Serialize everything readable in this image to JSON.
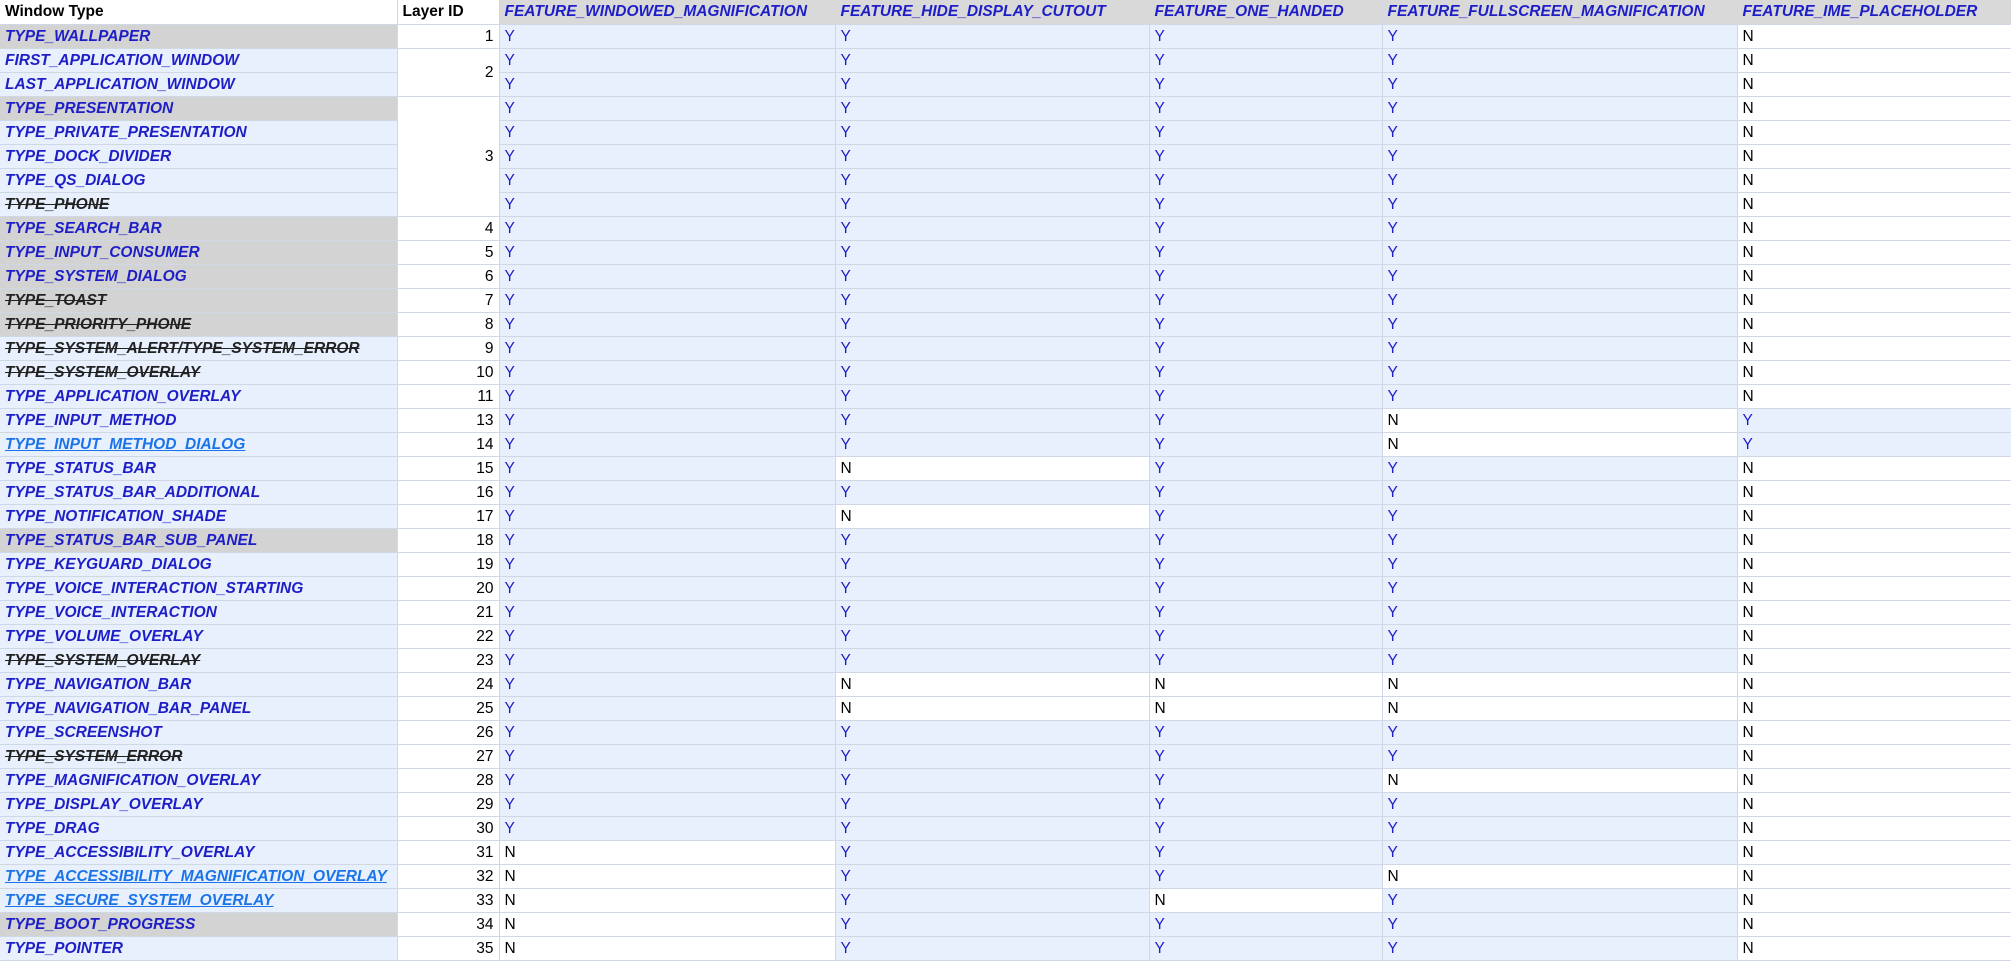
{
  "headers": [
    "Window Type",
    "Layer ID",
    "FEATURE_WINDOWED_MAGNIFICATION",
    "FEATURE_HIDE_DISPLAY_CUTOUT",
    "FEATURE_ONE_HANDED",
    "FEATURE_FULLSCREEN_MAGNIFICATION",
    "FEATURE_IME_PLACEHOLDER"
  ],
  "colors": {
    "cell_blue_bg": "#e7f0fc",
    "grey_bg": "#d3d3d3",
    "header_feature_bg": "#d9d9d9",
    "blue_text": "#1e1ec8",
    "link_text": "#1a73e8"
  },
  "rows": [
    {
      "name": "TYPE_WALLPAPER",
      "style": "blue-grey",
      "layer": "1",
      "span": 1,
      "v": [
        "Y",
        "Y",
        "Y",
        "Y",
        "N"
      ]
    },
    {
      "name": "FIRST_APPLICATION_WINDOW",
      "style": "blue",
      "layer": "2",
      "span": 2,
      "v": [
        "Y",
        "Y",
        "Y",
        "Y",
        "N"
      ]
    },
    {
      "name": "LAST_APPLICATION_WINDOW",
      "style": "blue",
      "layer": null,
      "span": 0,
      "v": [
        "Y",
        "Y",
        "Y",
        "Y",
        "N"
      ]
    },
    {
      "name": "TYPE_PRESENTATION",
      "style": "blue-grey",
      "layer": "3",
      "span": 5,
      "v": [
        "Y",
        "Y",
        "Y",
        "Y",
        "N"
      ]
    },
    {
      "name": "TYPE_PRIVATE_PRESENTATION",
      "style": "blue",
      "layer": null,
      "span": 0,
      "v": [
        "Y",
        "Y",
        "Y",
        "Y",
        "N"
      ]
    },
    {
      "name": "TYPE_DOCK_DIVIDER",
      "style": "blue",
      "layer": null,
      "span": 0,
      "v": [
        "Y",
        "Y",
        "Y",
        "Y",
        "N"
      ]
    },
    {
      "name": "TYPE_QS_DIALOG",
      "style": "blue",
      "layer": null,
      "span": 0,
      "v": [
        "Y",
        "Y",
        "Y",
        "Y",
        "N"
      ]
    },
    {
      "name": "TYPE_PHONE",
      "style": "strike",
      "layer": null,
      "span": 0,
      "v": [
        "Y",
        "Y",
        "Y",
        "Y",
        "N"
      ]
    },
    {
      "name": "TYPE_SEARCH_BAR",
      "style": "blue-grey",
      "layer": "4",
      "span": 1,
      "v": [
        "Y",
        "Y",
        "Y",
        "Y",
        "N"
      ]
    },
    {
      "name": "TYPE_INPUT_CONSUMER",
      "style": "blue-grey",
      "layer": "5",
      "span": 1,
      "v": [
        "Y",
        "Y",
        "Y",
        "Y",
        "N"
      ]
    },
    {
      "name": "TYPE_SYSTEM_DIALOG",
      "style": "blue-grey",
      "layer": "6",
      "span": 1,
      "v": [
        "Y",
        "Y",
        "Y",
        "Y",
        "N"
      ]
    },
    {
      "name": "TYPE_TOAST",
      "style": "strike-grey",
      "layer": "7",
      "span": 1,
      "v": [
        "Y",
        "Y",
        "Y",
        "Y",
        "N"
      ]
    },
    {
      "name": "TYPE_PRIORITY_PHONE",
      "style": "strike-grey",
      "layer": "8",
      "span": 1,
      "v": [
        "Y",
        "Y",
        "Y",
        "Y",
        "N"
      ]
    },
    {
      "name": "TYPE_SYSTEM_ALERT/TYPE_SYSTEM_ERROR",
      "style": "strike",
      "layer": "9",
      "span": 1,
      "v": [
        "Y",
        "Y",
        "Y",
        "Y",
        "N"
      ]
    },
    {
      "name": "TYPE_SYSTEM_OVERLAY",
      "style": "strike",
      "layer": "10",
      "span": 1,
      "v": [
        "Y",
        "Y",
        "Y",
        "Y",
        "N"
      ]
    },
    {
      "name": "TYPE_APPLICATION_OVERLAY",
      "style": "blue",
      "layer": "11",
      "span": 1,
      "v": [
        "Y",
        "Y",
        "Y",
        "Y",
        "N"
      ]
    },
    {
      "name": "TYPE_INPUT_METHOD",
      "style": "blue",
      "layer": "13",
      "span": 1,
      "v": [
        "Y",
        "Y",
        "Y",
        "N",
        "Y"
      ]
    },
    {
      "name": "TYPE_INPUT_METHOD_DIALOG",
      "style": "link",
      "layer": "14",
      "span": 1,
      "v": [
        "Y",
        "Y",
        "Y",
        "N",
        "Y"
      ]
    },
    {
      "name": "TYPE_STATUS_BAR",
      "style": "blue",
      "layer": "15",
      "span": 1,
      "v": [
        "Y",
        "N",
        "Y",
        "Y",
        "N"
      ]
    },
    {
      "name": "TYPE_STATUS_BAR_ADDITIONAL",
      "style": "blue",
      "layer": "16",
      "span": 1,
      "v": [
        "Y",
        "Y",
        "Y",
        "Y",
        "N"
      ]
    },
    {
      "name": "TYPE_NOTIFICATION_SHADE",
      "style": "blue",
      "layer": "17",
      "span": 1,
      "v": [
        "Y",
        "N",
        "Y",
        "Y",
        "N"
      ]
    },
    {
      "name": "TYPE_STATUS_BAR_SUB_PANEL",
      "style": "blue-grey",
      "layer": "18",
      "span": 1,
      "v": [
        "Y",
        "Y",
        "Y",
        "Y",
        "N"
      ]
    },
    {
      "name": "TYPE_KEYGUARD_DIALOG",
      "style": "blue",
      "layer": "19",
      "span": 1,
      "v": [
        "Y",
        "Y",
        "Y",
        "Y",
        "N"
      ]
    },
    {
      "name": "TYPE_VOICE_INTERACTION_STARTING",
      "style": "blue",
      "layer": "20",
      "span": 1,
      "v": [
        "Y",
        "Y",
        "Y",
        "Y",
        "N"
      ]
    },
    {
      "name": "TYPE_VOICE_INTERACTION",
      "style": "blue",
      "layer": "21",
      "span": 1,
      "v": [
        "Y",
        "Y",
        "Y",
        "Y",
        "N"
      ]
    },
    {
      "name": "TYPE_VOLUME_OVERLAY",
      "style": "blue",
      "layer": "22",
      "span": 1,
      "v": [
        "Y",
        "Y",
        "Y",
        "Y",
        "N"
      ]
    },
    {
      "name": "TYPE_SYSTEM_OVERLAY",
      "style": "strike",
      "layer": "23",
      "span": 1,
      "v": [
        "Y",
        "Y",
        "Y",
        "Y",
        "N"
      ]
    },
    {
      "name": "TYPE_NAVIGATION_BAR",
      "style": "blue",
      "layer": "24",
      "span": 1,
      "v": [
        "Y",
        "N",
        "N",
        "N",
        "N"
      ]
    },
    {
      "name": "TYPE_NAVIGATION_BAR_PANEL",
      "style": "blue",
      "layer": "25",
      "span": 1,
      "v": [
        "Y",
        "N",
        "N",
        "N",
        "N"
      ]
    },
    {
      "name": "TYPE_SCREENSHOT",
      "style": "blue",
      "layer": "26",
      "span": 1,
      "v": [
        "Y",
        "Y",
        "Y",
        "Y",
        "N"
      ]
    },
    {
      "name": "TYPE_SYSTEM_ERROR",
      "style": "strike",
      "layer": "27",
      "span": 1,
      "v": [
        "Y",
        "Y",
        "Y",
        "Y",
        "N"
      ]
    },
    {
      "name": "TYPE_MAGNIFICATION_OVERLAY",
      "style": "blue",
      "layer": "28",
      "span": 1,
      "v": [
        "Y",
        "Y",
        "Y",
        "N",
        "N"
      ]
    },
    {
      "name": "TYPE_DISPLAY_OVERLAY",
      "style": "blue",
      "layer": "29",
      "span": 1,
      "v": [
        "Y",
        "Y",
        "Y",
        "Y",
        "N"
      ]
    },
    {
      "name": "TYPE_DRAG",
      "style": "blue",
      "layer": "30",
      "span": 1,
      "v": [
        "Y",
        "Y",
        "Y",
        "Y",
        "N"
      ]
    },
    {
      "name": "TYPE_ACCESSIBILITY_OVERLAY",
      "style": "blue",
      "layer": "31",
      "span": 1,
      "v": [
        "N",
        "Y",
        "Y",
        "Y",
        "N"
      ]
    },
    {
      "name": "TYPE_ACCESSIBILITY_MAGNIFICATION_OVERLAY",
      "style": "link",
      "layer": "32",
      "span": 1,
      "v": [
        "N",
        "Y",
        "Y",
        "N",
        "N"
      ]
    },
    {
      "name": "TYPE_SECURE_SYSTEM_OVERLAY",
      "style": "link",
      "layer": "33",
      "span": 1,
      "v": [
        "N",
        "Y",
        "N",
        "Y",
        "N"
      ]
    },
    {
      "name": "TYPE_BOOT_PROGRESS",
      "style": "blue-grey",
      "layer": "34",
      "span": 1,
      "v": [
        "N",
        "Y",
        "Y",
        "Y",
        "N"
      ]
    },
    {
      "name": "TYPE_POINTER",
      "style": "blue",
      "layer": "35",
      "span": 1,
      "v": [
        "N",
        "Y",
        "Y",
        "Y",
        "N"
      ]
    }
  ]
}
